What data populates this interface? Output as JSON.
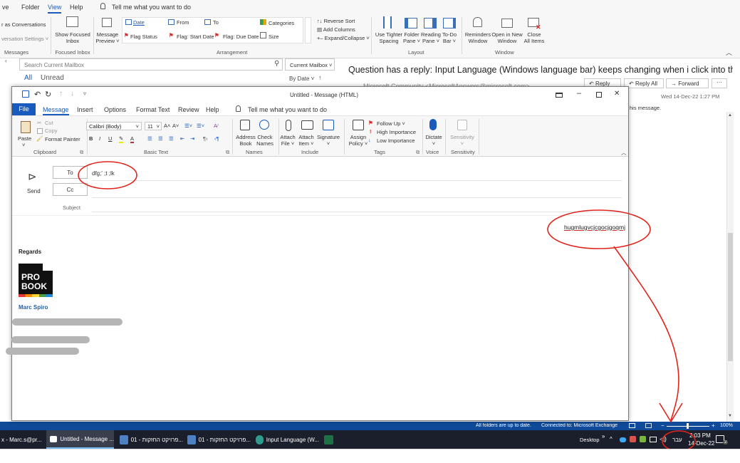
{
  "back_ribbon": {
    "tabs": [
      "ve",
      "Folder",
      "View",
      "Help"
    ],
    "tellme": "Tell me what you want to do",
    "show_as_conversations": "r as Conversations",
    "conversation_settings": "versation Settings ˅",
    "messages_group": "Messages",
    "show_focused_inbox": [
      "Show Focused",
      "Inbox"
    ],
    "focused_inbox_group": "Focused Inbox",
    "message_preview": [
      "Message",
      "Preview ˅"
    ],
    "arrangement_items": [
      "Date",
      "From",
      "To",
      "Categories",
      "Flag Status",
      "Flag: Start Date",
      "Flag: Due Date",
      "Size"
    ],
    "reverse_sort": "Reverse Sort",
    "add_columns": "Add Columns",
    "expand_collapse": "Expand/Collapse ˅",
    "arrangement_group": "Arrangement",
    "layout_buttons": [
      [
        "Use Tighter",
        "Spacing"
      ],
      [
        "Folder",
        "Pane ˅"
      ],
      [
        "Reading",
        "Pane ˅"
      ],
      [
        "To-Do",
        "Bar ˅"
      ]
    ],
    "layout_group": "Layout",
    "window_buttons": [
      [
        "Reminders",
        "Window"
      ],
      [
        "Open in New",
        "Window"
      ],
      [
        "Close",
        "All Items"
      ]
    ],
    "window_group": "Window"
  },
  "mail_list": {
    "search_placeholder": "Search Current Mailbox",
    "scope": "Current Mailbox",
    "filter_all": "All",
    "filter_unread": "Unread",
    "sort": "By Date ˅"
  },
  "reading_pane": {
    "subject": "Question has a reply: Input Language (Windows language bar) keeps changing when i click into the ...",
    "reply": "Reply",
    "reply_all": "Reply All",
    "forward": "Forward",
    "from_partial": "Microsoft Community <MicrosoftAnswers@microsoft.com>",
    "date": "Wed 14-Dec-22 1:27 PM",
    "info_partial": "his message."
  },
  "compose": {
    "title": "Untitled  -  Message (HTML)",
    "tabs": [
      "File",
      "Message",
      "Insert",
      "Options",
      "Format Text",
      "Review",
      "Help"
    ],
    "tellme": "Tell me what you want to do",
    "clipboard": {
      "paste": "Paste",
      "cut": "Cut",
      "copy": "Copy",
      "format_painter": "Format Painter",
      "group": "Clipboard"
    },
    "basic_text": {
      "font": "Calibri (Body)",
      "size": "11",
      "group": "Basic Text"
    },
    "names": {
      "address_book": [
        "Address",
        "Book"
      ],
      "check_names": [
        "Check",
        "Names"
      ],
      "group": "Names"
    },
    "include": {
      "attach_file": [
        "Attach",
        "File ˅"
      ],
      "attach_item": [
        "Attach",
        "Item ˅"
      ],
      "signature": [
        "Signature",
        "˅"
      ],
      "group": "Include"
    },
    "tags": {
      "assign_policy": [
        "Assign",
        "Policy ˅"
      ],
      "follow_up": "Follow Up ˅",
      "high_importance": "High Importance",
      "low_importance": "Low Importance",
      "group": "Tags"
    },
    "voice": {
      "dictate": [
        "Dictate",
        "˅"
      ],
      "group": "Voice"
    },
    "sensitivity": {
      "label": [
        "Sensitivity",
        "˅"
      ],
      "group": "Sensitivity"
    },
    "send": "Send",
    "to_label": "To",
    "to_value": "dfg;'  ;t ;lk",
    "cc_label": "Cc",
    "subject_label": "Subject",
    "body_typed": "hugmlugvcjcgocjgoqmj",
    "regards": "Regards",
    "logo_top": "PRO",
    "logo_bottom": "BOOK",
    "signature_name": "Marc Spiro"
  },
  "statusbar": {
    "status": "All folders are up to date.",
    "connection": "Connected to: Microsoft Exchange",
    "zoom": "100%"
  },
  "taskbar": {
    "items": [
      "x - Marc.s@pr...",
      "Untitled - Message ...",
      "01 - פרויקט החזקות...",
      "01 - פרויקט החזקות...",
      "Input Language (W..."
    ],
    "desktop": "Desktop",
    "lang": "עבר",
    "time": "2:03 PM",
    "date": "14-Dec-22",
    "notif_count": "2"
  },
  "colors": {
    "outlook_blue": "#185abd",
    "taskbar": "#1b1f2b",
    "status_blue": "#0f4b99",
    "annotation_red": "#e0241b",
    "sig_blue": "#1f5ea8"
  }
}
